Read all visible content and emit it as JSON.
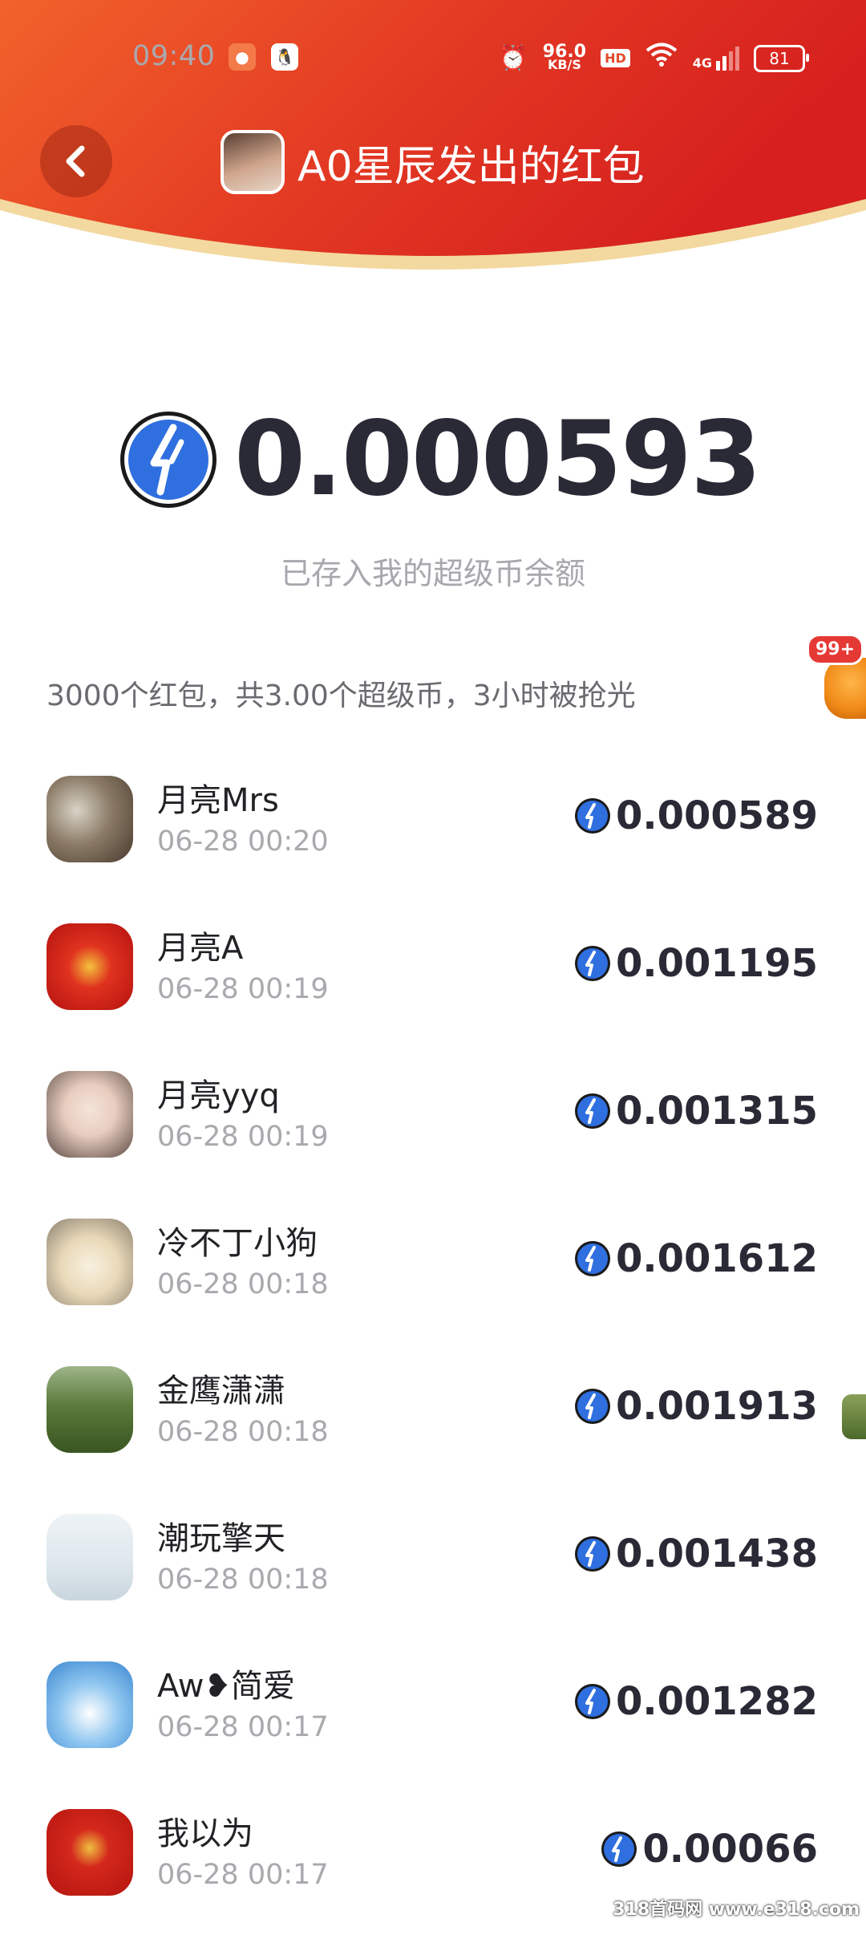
{
  "status_bar": {
    "time": "09:40",
    "net_speed_value": "96.0",
    "net_speed_unit": "KB/S",
    "hd_label": "HD",
    "network_label": "4G",
    "battery": "81"
  },
  "header": {
    "title": "A0星辰发出的红包",
    "back_icon": "chevron-left-icon"
  },
  "received": {
    "amount": "0.000593",
    "note": "已存入我的超级币余额"
  },
  "summary": "3000个红包，共3.00个超级币，3小时被抢光",
  "floating_badge": "99+",
  "records": [
    {
      "name": "月亮Mrs",
      "time": "06-28 00:20",
      "amount": "0.000589"
    },
    {
      "name": "月亮A",
      "time": "06-28 00:19",
      "amount": "0.001195"
    },
    {
      "name": "月亮yyq",
      "time": "06-28 00:19",
      "amount": "0.001315"
    },
    {
      "name": "冷不丁小狗",
      "time": "06-28 00:18",
      "amount": "0.001612"
    },
    {
      "name": "金鹰潇潇",
      "time": "06-28 00:18",
      "amount": "0.001913"
    },
    {
      "name": "潮玩擎天",
      "time": "06-28 00:18",
      "amount": "0.001438"
    },
    {
      "name": "Aw❥简爱",
      "time": "06-28 00:17",
      "amount": "0.001282"
    },
    {
      "name": "我以为",
      "time": "06-28 00:17",
      "amount": "0.00066"
    }
  ],
  "watermark": "318首码网 www.e318.com",
  "colors": {
    "header_red": "#e0321f",
    "header_orange": "#f0602a",
    "header_gold_band": "#f3d9a0",
    "coin_blue": "#2f6fe0",
    "amount_text": "#2a2a36"
  }
}
